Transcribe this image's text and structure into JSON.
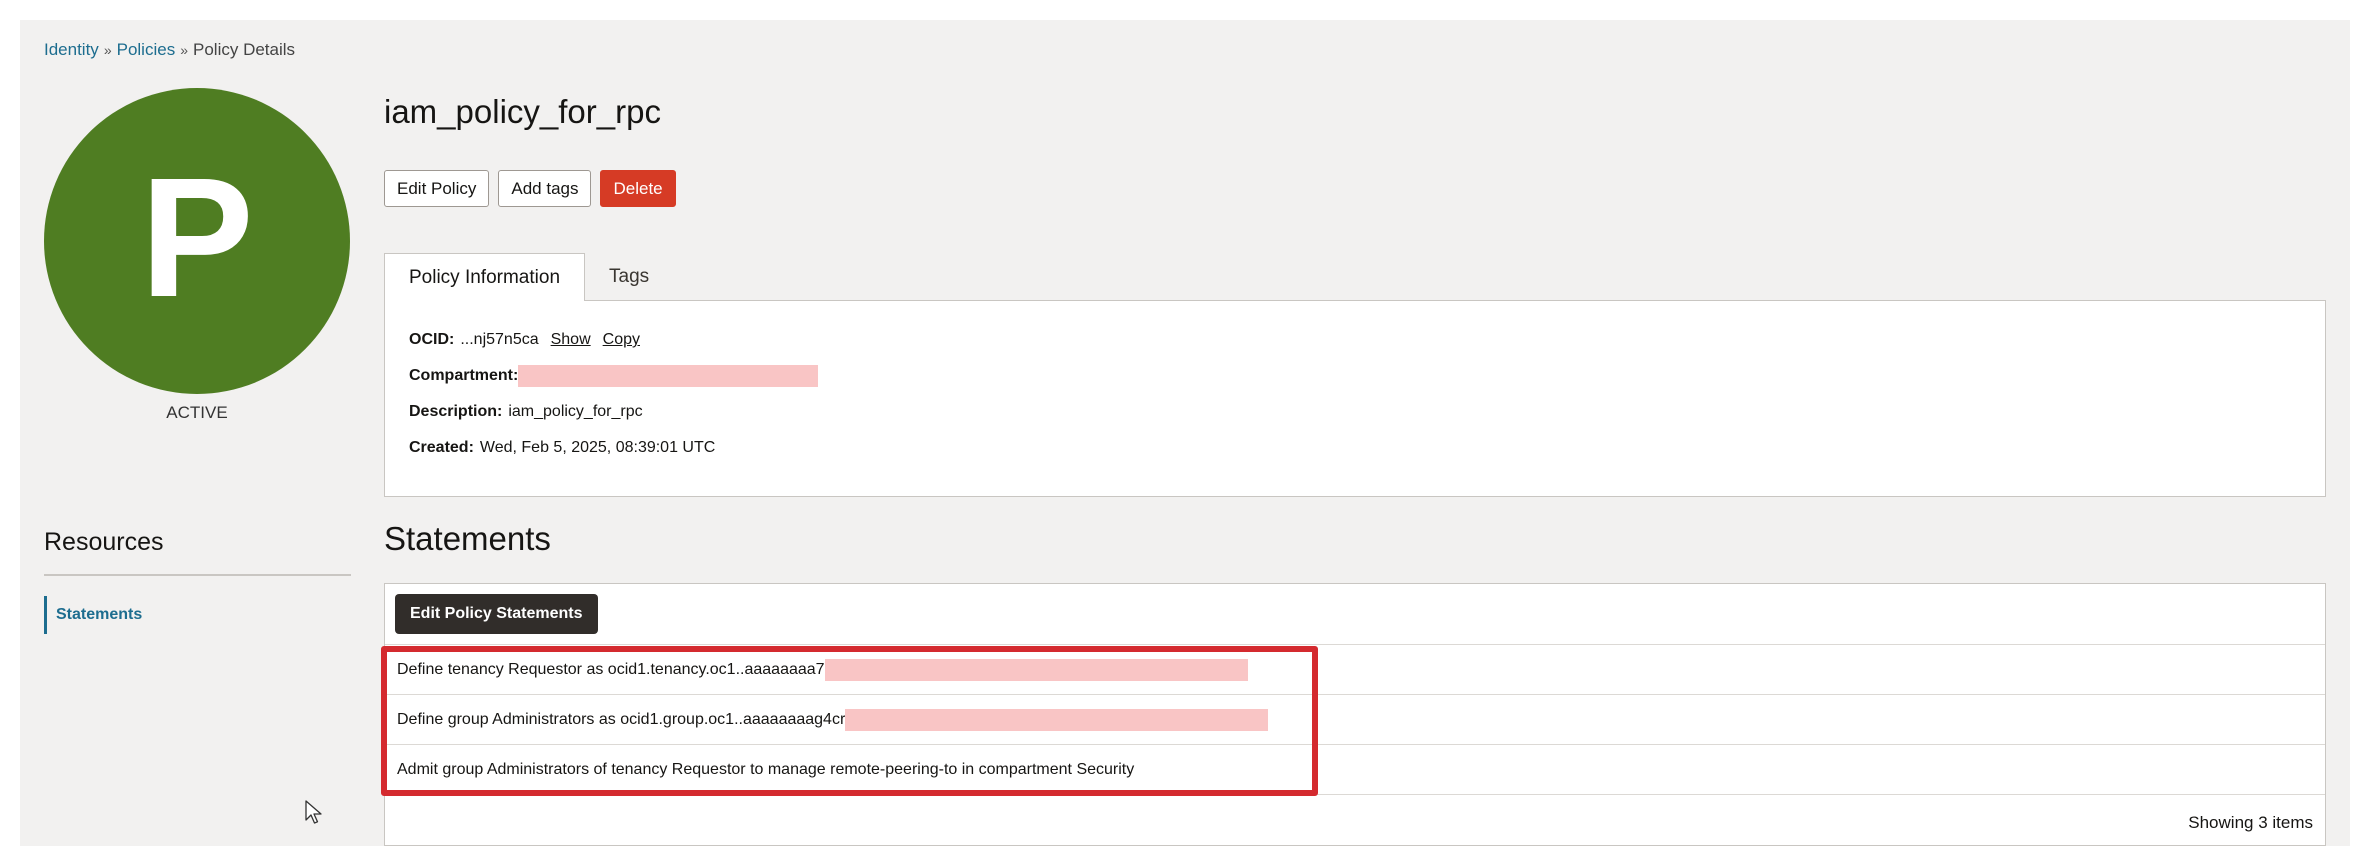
{
  "breadcrumb": {
    "items": [
      "Identity",
      "Policies"
    ],
    "current": "Policy Details",
    "separator": "»"
  },
  "avatar": {
    "letter": "P",
    "color": "#4f7d22"
  },
  "status": "ACTIVE",
  "resources": {
    "title": "Resources",
    "items": [
      {
        "label": "Statements",
        "active": true
      }
    ]
  },
  "policy": {
    "title": "iam_policy_for_rpc",
    "actions": {
      "edit": "Edit Policy",
      "tags": "Add tags",
      "delete": "Delete"
    },
    "tabs": [
      "Policy Information",
      "Tags"
    ],
    "info": {
      "ocid_label": "OCID:",
      "ocid_value": "...nj57n5ca",
      "show_link": "Show",
      "copy_link": "Copy",
      "compartment_label": "Compartment:",
      "description_label": "Description:",
      "description_value": "iam_policy_for_rpc",
      "created_label": "Created:",
      "created_value": "Wed, Feb 5, 2025, 08:39:01 UTC"
    }
  },
  "statements": {
    "title": "Statements",
    "edit_button": "Edit Policy Statements",
    "rows": [
      "Define tenancy Requestor as ocid1.tenancy.oc1..aaaaaaaa7",
      "Define group Administrators as ocid1.group.oc1..aaaaaaaag4cr",
      "Admit group Administrators of tenancy Requestor to manage remote-peering-to in compartment Security"
    ],
    "footer": "Showing 3 items"
  },
  "colors": {
    "accent_link": "#1d6d8f",
    "danger": "#d63b25",
    "highlight": "#d42a2f",
    "redaction": "#f9c5c5"
  }
}
